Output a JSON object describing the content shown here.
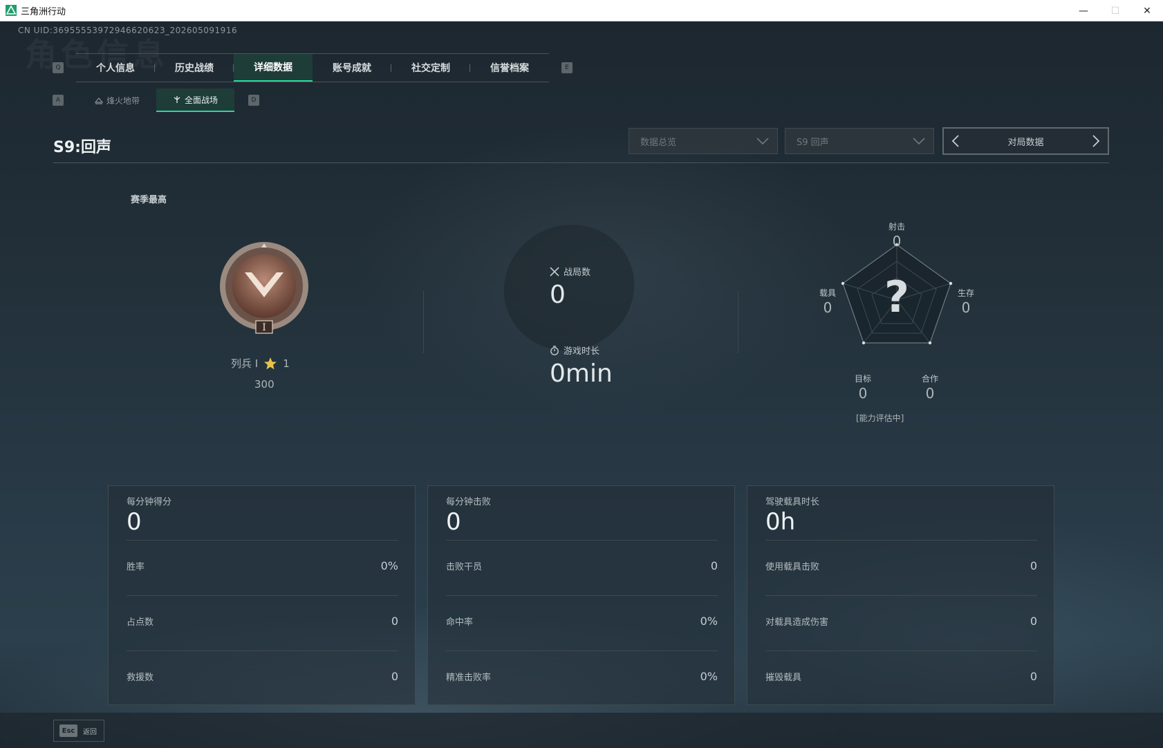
{
  "window": {
    "title": "三角洲行动",
    "minimize": "—",
    "maximize": "☐",
    "close": "✕"
  },
  "header": {
    "uid": "CN UID:36955553972946620623_202605091916",
    "watermark": "角色信息",
    "tab_left_key": "Q",
    "tab_right_key": "E",
    "tabs": [
      {
        "label": "个人信息"
      },
      {
        "label": "历史战绩"
      },
      {
        "label": "详细数据"
      },
      {
        "label": "账号成就"
      },
      {
        "label": "社交定制"
      },
      {
        "label": "信誉档案"
      }
    ],
    "active_tab": 2,
    "subtab_left_key": "A",
    "subtab_right_key": "D",
    "subtabs": [
      {
        "label": "烽火地带"
      },
      {
        "label": "全面战场"
      }
    ],
    "active_subtab": 1
  },
  "season": {
    "title": "S9:回声",
    "filter_dropdown": "数据总览",
    "season_dropdown": "S9 回声",
    "pager_label": "对局数据"
  },
  "rank": {
    "label": "赛季最高",
    "name": "列兵 I",
    "stars": "1",
    "score": "300"
  },
  "overview": {
    "matches_label": "战局数",
    "matches_value": "0",
    "playtime_label": "游戏时长",
    "playtime_value": "0min"
  },
  "radar": {
    "center": "?",
    "status": "[能力评估中]",
    "axes": [
      {
        "label": "射击",
        "value": "0"
      },
      {
        "label": "生存",
        "value": "0"
      },
      {
        "label": "合作",
        "value": "0"
      },
      {
        "label": "目标",
        "value": "0"
      },
      {
        "label": "载具",
        "value": "0"
      }
    ]
  },
  "cards": [
    {
      "title": "每分钟得分",
      "value": "0",
      "rows": [
        {
          "label": "胜率",
          "value": "0%"
        },
        {
          "label": "占点数",
          "value": "0"
        },
        {
          "label": "救援数",
          "value": "0"
        }
      ]
    },
    {
      "title": "每分钟击败",
      "value": "0",
      "rows": [
        {
          "label": "击败干员",
          "value": "0"
        },
        {
          "label": "命中率",
          "value": "0%"
        },
        {
          "label": "精准击败率",
          "value": "0%"
        }
      ]
    },
    {
      "title": "驾驶载具时长",
      "value": "0h",
      "rows": [
        {
          "label": "使用载具击败",
          "value": "0"
        },
        {
          "label": "对载具造成伤害",
          "value": "0"
        },
        {
          "label": "摧毁载具",
          "value": "0"
        }
      ]
    }
  ],
  "footer": {
    "esc_key": "Esc",
    "back_label": "返回"
  },
  "colors": {
    "accent": "#2fd59b",
    "star": "#e8c24a",
    "rank_bronze": "#8a5a48"
  }
}
